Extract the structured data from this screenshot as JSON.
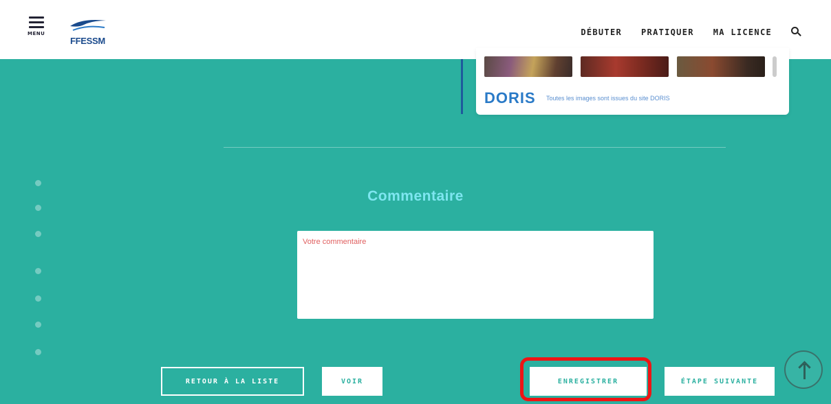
{
  "header": {
    "menu_label": "MENU",
    "logo_text": "FFESSM",
    "nav": [
      {
        "label": "DÉBUTER"
      },
      {
        "label": "PRATIQUER"
      },
      {
        "label": "MA LICENCE"
      }
    ],
    "search_icon": "search-icon"
  },
  "doris": {
    "logo": "DORIS",
    "note": "Toutes les images sont issues du site DORIS"
  },
  "comment": {
    "title": "Commentaire",
    "placeholder": "Votre commentaire",
    "value": ""
  },
  "actions": {
    "back": "RETOUR À LA LISTE",
    "voir": "VOIR",
    "save": "ENREGISTRER",
    "next": "ÉTAPE SUIVANTE"
  },
  "colors": {
    "background": "#2bb0a0",
    "highlight": "#ee1515",
    "title": "#7ee6f0"
  }
}
